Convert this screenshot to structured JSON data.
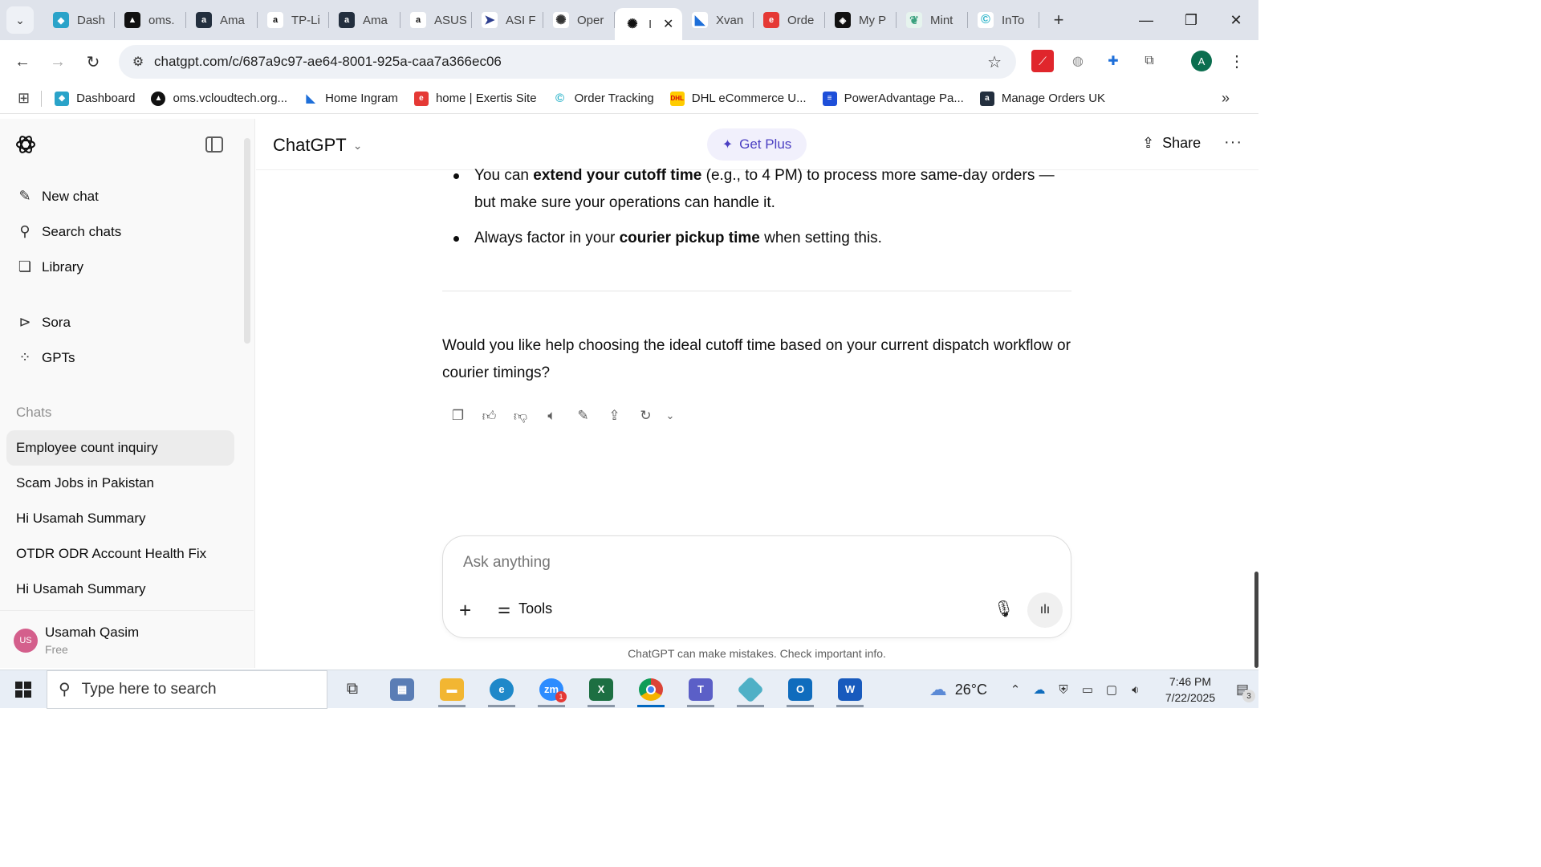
{
  "browser": {
    "tabs": [
      {
        "label": "Dash",
        "icon": "dashboard-icon",
        "color": "#2aa3c9"
      },
      {
        "label": "oms.",
        "icon": "triangle-icon",
        "color": "#111111"
      },
      {
        "label": "Ama",
        "icon": "amazon-icon",
        "color": "#232f3e"
      },
      {
        "label": "TP-Li",
        "icon": "amazon-icon",
        "color": "#ffffff"
      },
      {
        "label": "Ama",
        "icon": "amazon-icon",
        "color": "#232f3e"
      },
      {
        "label": "ASUS",
        "icon": "amazon-icon",
        "color": "#ffffff"
      },
      {
        "label": "ASI F",
        "icon": "arrow-icon",
        "color": "#2d3e8f"
      },
      {
        "label": "Oper",
        "icon": "openai-icon",
        "color": "#ffffff"
      },
      {
        "label": "I",
        "icon": "openai-icon",
        "color": "#ffffff"
      },
      {
        "label": "Xvan",
        "icon": "xvantage-icon",
        "color": "#1e6fd9"
      },
      {
        "label": "Orde",
        "icon": "exertis-icon",
        "color": "#e53935"
      },
      {
        "label": "My P",
        "icon": "tag-icon",
        "color": "#111111"
      },
      {
        "label": "Mint",
        "icon": "leaf-icon",
        "color": "#3aa17e"
      },
      {
        "label": "InTo",
        "icon": "c-icon",
        "color": "#2ab3c9"
      }
    ],
    "url": "chatgpt.com/c/687a9c97-ae64-8001-925a-caa7a366ec06",
    "profile_initial": "A",
    "bookmarks": [
      {
        "label": "Dashboard",
        "color": "#2aa3c9"
      },
      {
        "label": "oms.vcloudtech.org...",
        "color": "#111111"
      },
      {
        "label": "Home Ingram",
        "color": "#1e6fd9"
      },
      {
        "label": "home | Exertis Site",
        "color": "#e53935"
      },
      {
        "label": "Order Tracking",
        "color": "#2ab3c9"
      },
      {
        "label": "DHL eCommerce U...",
        "color": "#ffcc00"
      },
      {
        "label": "PowerAdvantage Pa...",
        "color": "#1e4fd9"
      },
      {
        "label": "Manage Orders UK",
        "color": "#232f3e"
      }
    ]
  },
  "sidebar": {
    "nav": [
      {
        "label": "New chat",
        "icon": "edit-icon"
      },
      {
        "label": "Search chats",
        "icon": "search-icon"
      },
      {
        "label": "Library",
        "icon": "library-icon"
      },
      {
        "label": "Sora",
        "icon": "play-circle-icon"
      },
      {
        "label": "GPTs",
        "icon": "grid-icon"
      }
    ],
    "section_label": "Chats",
    "chats": [
      "Employee count inquiry",
      "Scam Jobs in Pakistan",
      "Hi Usamah Summary",
      "OTDR ODR Account Health Fix",
      "Hi Usamah Summary"
    ],
    "user": {
      "initials": "US",
      "name": "Usamah Qasim",
      "plan": "Free"
    }
  },
  "header": {
    "model": "ChatGPT",
    "get_plus": "Get Plus",
    "share": "Share"
  },
  "message": {
    "bullet1_pre": "You can ",
    "bullet1_bold": "extend your cutoff time",
    "bullet1_post": " (e.g., to 4 PM) to process more same-day orders — but make sure your operations can handle it.",
    "bullet2_pre": "Always factor in your ",
    "bullet2_bold": "courier pickup time",
    "bullet2_post": " when setting this.",
    "question": "Would you like help choosing the ideal cutoff time based on your current dispatch workflow or courier timings?"
  },
  "composer": {
    "placeholder": "Ask anything",
    "tools_label": "Tools",
    "disclaimer": "ChatGPT can make mistakes. Check important info."
  },
  "taskbar": {
    "search_placeholder": "Type here to search",
    "weather": "26°C",
    "time": "7:46 PM",
    "date": "7/22/2025",
    "notifications": "3",
    "zoom_badge": "1"
  }
}
